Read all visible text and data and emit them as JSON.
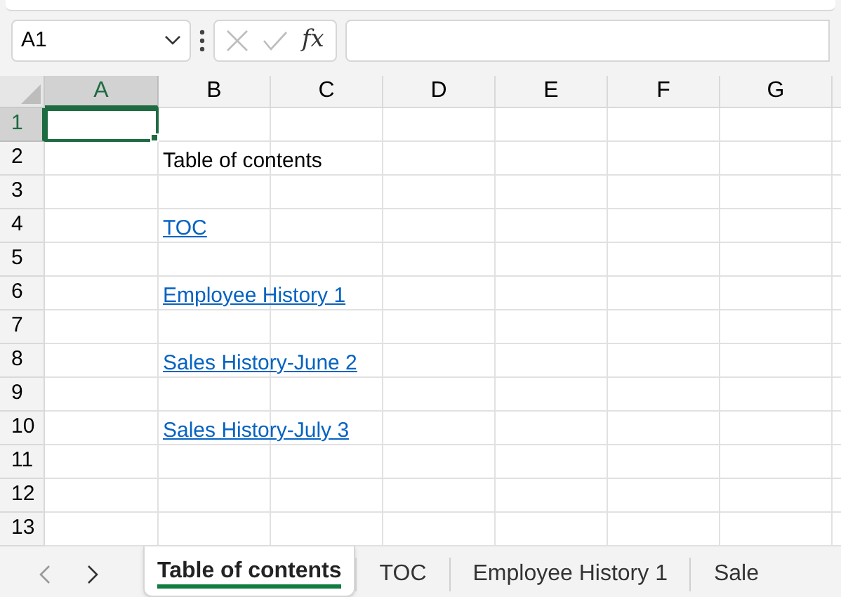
{
  "formula_bar": {
    "name_box": "A1",
    "function_label": "fx"
  },
  "columns": [
    {
      "label": "A",
      "selected": true
    },
    {
      "label": "B",
      "selected": false
    },
    {
      "label": "C",
      "selected": false
    },
    {
      "label": "D",
      "selected": false
    },
    {
      "label": "E",
      "selected": false
    },
    {
      "label": "F",
      "selected": false
    },
    {
      "label": "G",
      "selected": false
    }
  ],
  "rows": [
    {
      "label": "1",
      "selected": true,
      "cells": {
        "A": {
          "selected": true
        }
      }
    },
    {
      "label": "2",
      "selected": false,
      "cells": {
        "B": {
          "kind": "text",
          "selected": false,
          "text": "Table of contents"
        }
      }
    },
    {
      "label": "3",
      "selected": false
    },
    {
      "label": "4",
      "selected": false,
      "cells": {
        "B": {
          "kind": "link",
          "selected": false,
          "text": "TOC"
        }
      }
    },
    {
      "label": "5",
      "selected": false
    },
    {
      "label": "6",
      "selected": false,
      "cells": {
        "B": {
          "kind": "link",
          "selected": false,
          "text": "Employee History 1"
        }
      }
    },
    {
      "label": "7",
      "selected": false
    },
    {
      "label": "8",
      "selected": false,
      "cells": {
        "B": {
          "kind": "link",
          "selected": false,
          "text": "Sales History-June 2"
        }
      }
    },
    {
      "label": "9",
      "selected": false
    },
    {
      "label": "10",
      "selected": false,
      "cells": {
        "B": {
          "kind": "link",
          "selected": false,
          "text": "Sales History-July 3"
        }
      }
    },
    {
      "label": "11",
      "selected": false
    },
    {
      "label": "12",
      "selected": false
    },
    {
      "label": "13",
      "selected": false
    }
  ],
  "sheet_tabs": [
    {
      "label": "Table of contents",
      "selected": true
    },
    {
      "label": "TOC",
      "selected": false
    },
    {
      "label": "Employee History 1",
      "selected": false
    },
    {
      "label": "Sale",
      "selected": false
    }
  ]
}
